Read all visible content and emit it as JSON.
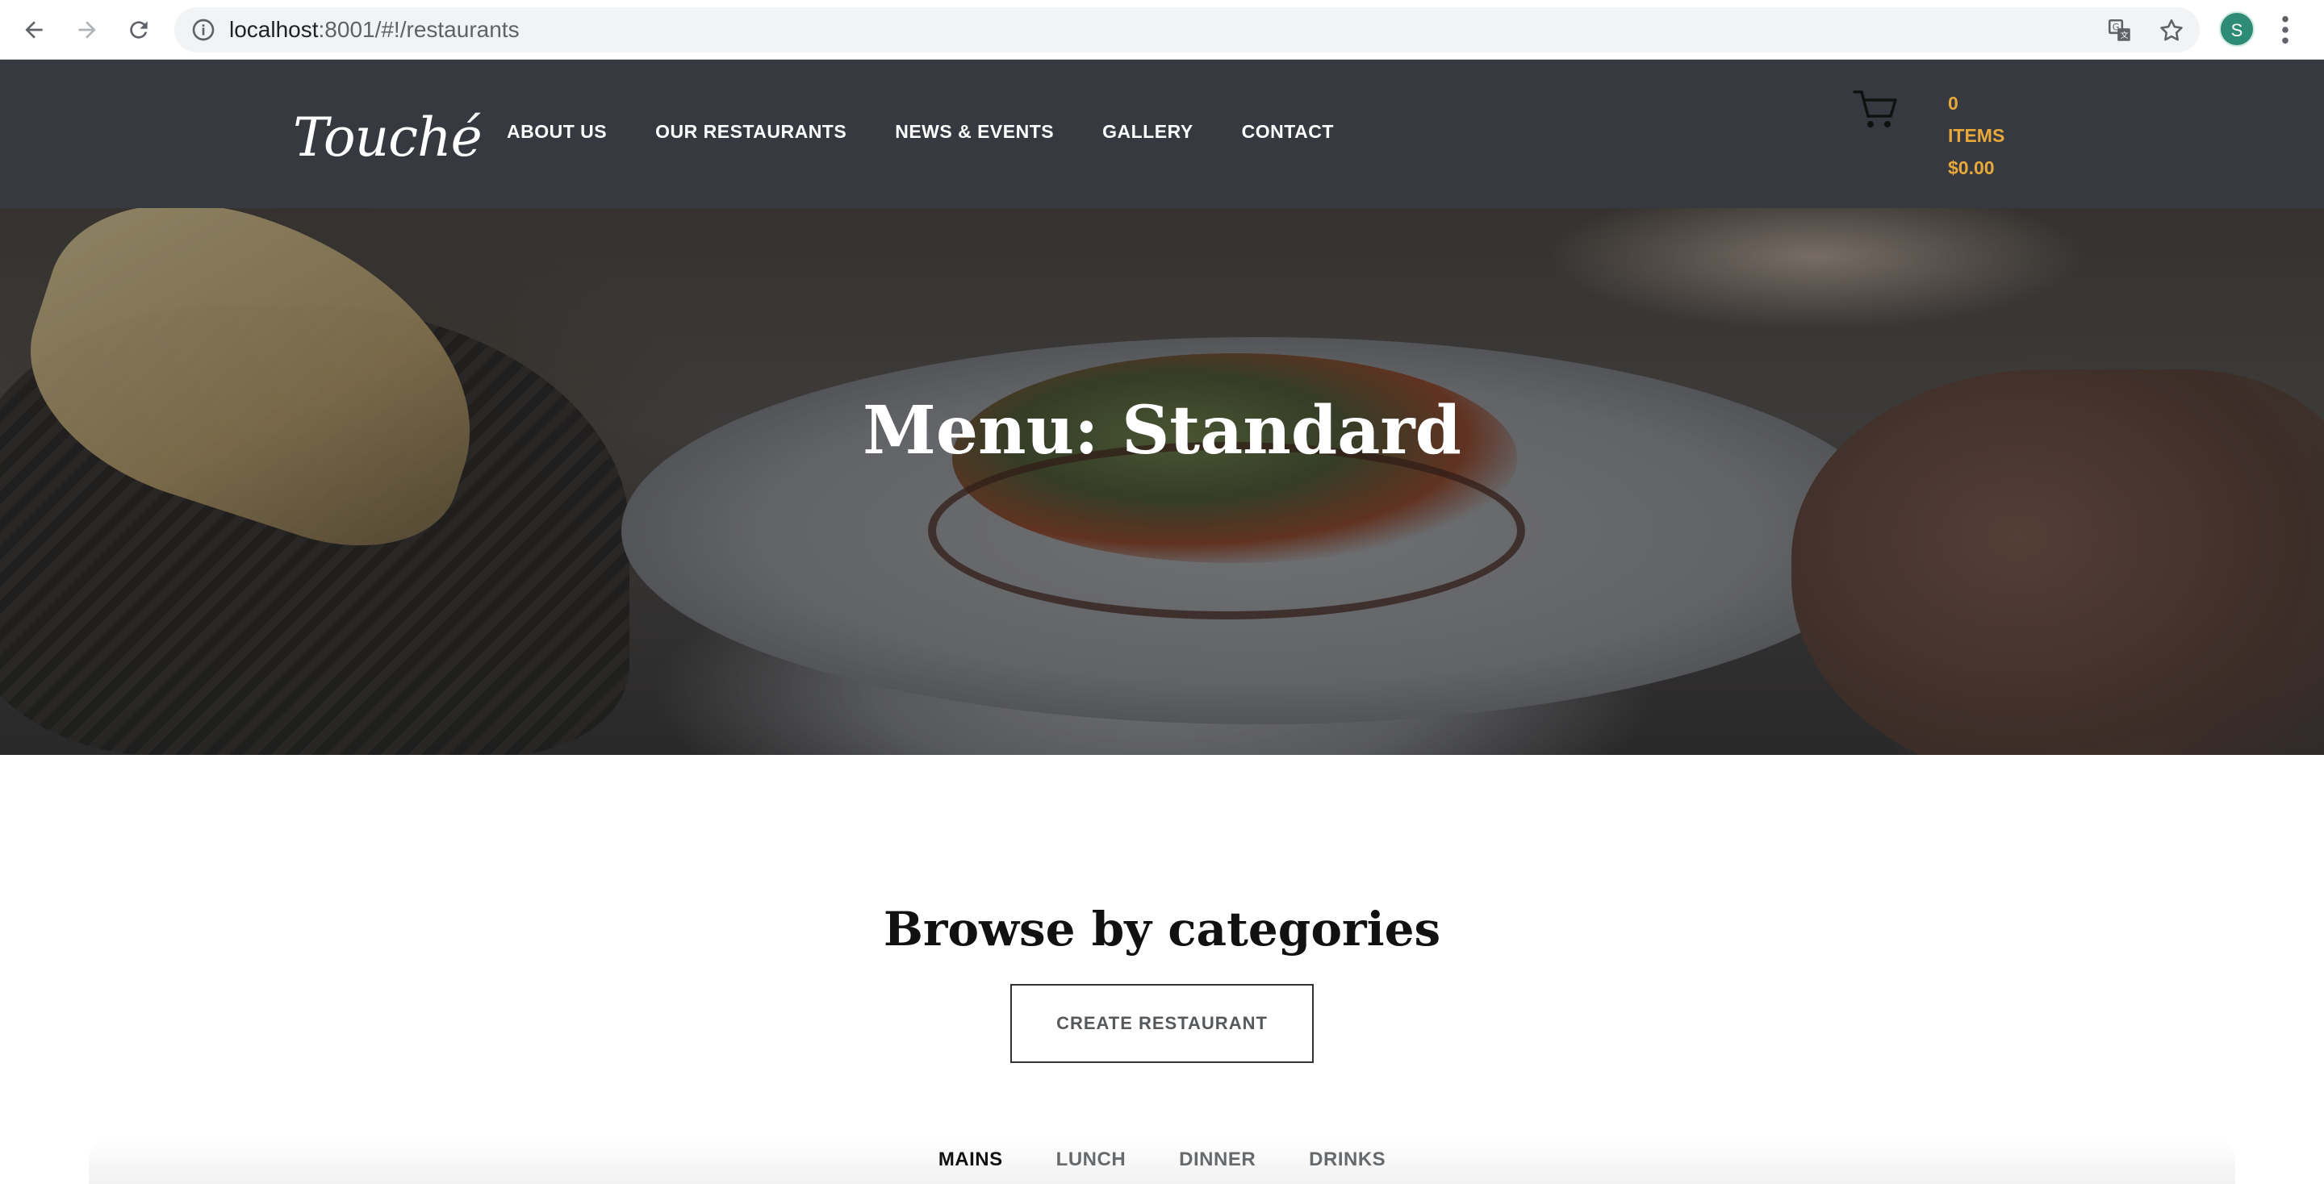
{
  "browser": {
    "url_host": "localhost",
    "url_rest": ":8001/#!/restaurants",
    "profile_initial": "S",
    "icons": [
      "back-arrow-icon",
      "forward-arrow-icon",
      "reload-icon",
      "info-icon",
      "translate-icon",
      "star-icon",
      "kebab-menu-icon"
    ]
  },
  "header": {
    "logo": "Touché",
    "nav": [
      {
        "label": "ABOUT US"
      },
      {
        "label": "OUR RESTAURANTS"
      },
      {
        "label": "NEWS & EVENTS"
      },
      {
        "label": "GALLERY"
      },
      {
        "label": "CONTACT"
      }
    ],
    "cart": {
      "count": "0",
      "items_label": "ITEMS",
      "total": "$0.00",
      "icon": "cart-icon"
    }
  },
  "hero": {
    "title": "Menu: Standard"
  },
  "main": {
    "browse_title": "Browse by categories",
    "create_button": "CREATE RESTAURANT",
    "tabs": [
      {
        "label": "MAINS",
        "active": true
      },
      {
        "label": "LUNCH",
        "active": false
      },
      {
        "label": "DINNER",
        "active": false
      },
      {
        "label": "DRINKS",
        "active": false
      }
    ]
  },
  "colors": {
    "header_bg": "#363a40",
    "cart_accent": "#e8a83a",
    "profile_bg": "#2e8b76"
  }
}
